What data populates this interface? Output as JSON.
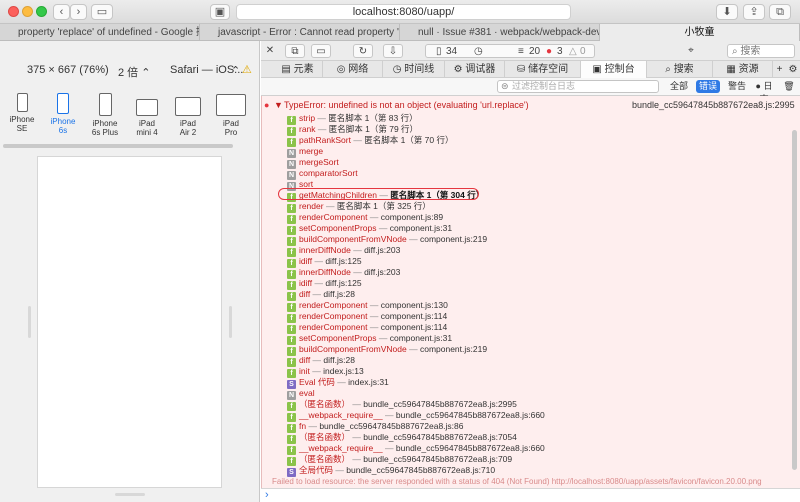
{
  "window": {
    "url": "localhost:8080/uapp/",
    "colors": {
      "accent": "#2f7ae5",
      "error": "#c21d1d",
      "function_badge": "#8bc34a",
      "native_badge": "#9e9e9e",
      "script_badge": "#7e6bc4"
    }
  },
  "tabs": [
    {
      "label": "property 'replace' of undefined - Google 搜索"
    },
    {
      "label": "javascript - Error : Cannot read property 'replace'..."
    },
    {
      "label": "null · Issue #381 · webpack/webpack-dev-server"
    },
    {
      "label": "小牧童"
    }
  ],
  "device_bar": {
    "resolution": "375 × 667 (76%)",
    "scale": "2 倍 ⌃",
    "browser": "Safari — iOS...",
    "warning_icon": "warning-icon"
  },
  "devices": [
    {
      "label1": "iPhone",
      "label2": "SE"
    },
    {
      "label1": "iPhone",
      "label2": "6s"
    },
    {
      "label1": "iPhone",
      "label2": "6s Plus"
    },
    {
      "label1": "iPad",
      "label2": "mini 4"
    },
    {
      "label1": "iPad",
      "label2": "Air 2"
    },
    {
      "label1": "iPad",
      "label2": "Pro"
    }
  ],
  "inspector_toolbar": {
    "stats": [
      {
        "icon": "document-icon",
        "value": "34"
      },
      {
        "icon": "clock-icon",
        "value": ""
      },
      {
        "icon": "list-icon",
        "value": "20"
      },
      {
        "icon": "error-icon",
        "value": "3"
      },
      {
        "icon": "warning-icon",
        "value": "0"
      }
    ],
    "search_placeholder": "搜索"
  },
  "panels": [
    {
      "label": "元素",
      "icon": "elements-icon"
    },
    {
      "label": "网络",
      "icon": "network-icon"
    },
    {
      "label": "时间线",
      "icon": "timeline-icon"
    },
    {
      "label": "调试器",
      "icon": "debugger-icon"
    },
    {
      "label": "储存空间",
      "icon": "storage-icon"
    },
    {
      "label": "控制台",
      "icon": "console-icon"
    },
    {
      "label": "搜索",
      "icon": "search-icon"
    },
    {
      "label": "资源",
      "icon": "resources-icon"
    }
  ],
  "filter": {
    "placeholder": "过滤控制台日志",
    "buttons": [
      {
        "label": "全部"
      },
      {
        "label": "错误"
      },
      {
        "label": "警告"
      },
      {
        "label": "日志"
      }
    ]
  },
  "error": {
    "message": "TypeError: undefined is not an object (evaluating 'url.replace')",
    "source": "bundle_cc59647845b887672ea8.js:2995"
  },
  "stack": [
    {
      "badge": "f",
      "fn": "strip",
      "loc": "匿名脚本 1（第 83 行）"
    },
    {
      "badge": "f",
      "fn": "rank",
      "loc": "匿名脚本 1（第 79 行）"
    },
    {
      "badge": "f",
      "fn": "pathRankSort",
      "loc": "匿名脚本 1（第 70 行）"
    },
    {
      "badge": "N",
      "fn": "merge",
      "loc": ""
    },
    {
      "badge": "N",
      "fn": "mergeSort",
      "loc": ""
    },
    {
      "badge": "N",
      "fn": "comparatorSort",
      "loc": ""
    },
    {
      "badge": "N",
      "fn": "sort",
      "loc": ""
    },
    {
      "badge": "f",
      "fn": "getMatchingChildren",
      "loc": "匿名脚本 1（第 304 行）"
    },
    {
      "badge": "f",
      "fn": "render",
      "loc": "匿名脚本 1（第 325 行）"
    },
    {
      "badge": "f",
      "fn": "renderComponent",
      "loc": "component.js:89"
    },
    {
      "badge": "f",
      "fn": "setComponentProps",
      "loc": "component.js:31"
    },
    {
      "badge": "f",
      "fn": "buildComponentFromVNode",
      "loc": "component.js:219"
    },
    {
      "badge": "f",
      "fn": "innerDiffNode",
      "loc": "diff.js:203"
    },
    {
      "badge": "f",
      "fn": "idiff",
      "loc": "diff.js:125"
    },
    {
      "badge": "f",
      "fn": "innerDiffNode",
      "loc": "diff.js:203"
    },
    {
      "badge": "f",
      "fn": "idiff",
      "loc": "diff.js:125"
    },
    {
      "badge": "f",
      "fn": "diff",
      "loc": "diff.js:28"
    },
    {
      "badge": "f",
      "fn": "renderComponent",
      "loc": "component.js:130"
    },
    {
      "badge": "f",
      "fn": "renderComponent",
      "loc": "component.js:114"
    },
    {
      "badge": "f",
      "fn": "renderComponent",
      "loc": "component.js:114"
    },
    {
      "badge": "f",
      "fn": "setComponentProps",
      "loc": "component.js:31"
    },
    {
      "badge": "f",
      "fn": "buildComponentFromVNode",
      "loc": "component.js:219"
    },
    {
      "badge": "f",
      "fn": "diff",
      "loc": "diff.js:28"
    },
    {
      "badge": "f",
      "fn": "init",
      "loc": "index.js:13"
    },
    {
      "badge": "S",
      "fn": "Eval 代码",
      "loc": "index.js:31"
    },
    {
      "badge": "N",
      "fn": "eval",
      "loc": ""
    },
    {
      "badge": "f",
      "fn": "（匿名函数）",
      "loc": "bundle_cc59647845b887672ea8.js:2995"
    },
    {
      "badge": "f",
      "fn": "__webpack_require__",
      "loc": "bundle_cc59647845b887672ea8.js:660"
    },
    {
      "badge": "f",
      "fn": "fn",
      "loc": "bundle_cc59647845b887672ea8.js:86"
    },
    {
      "badge": "f",
      "fn": "（匿名函数）",
      "loc": "bundle_cc59647845b887672ea8.js:7054"
    },
    {
      "badge": "f",
      "fn": "__webpack_require__",
      "loc": "bundle_cc59647845b887672ea8.js:660"
    },
    {
      "badge": "f",
      "fn": "（匿名函数）",
      "loc": "bundle_cc59647845b887672ea8.js:709"
    },
    {
      "badge": "S",
      "fn": "全局代码",
      "loc": "bundle_cc59647845b887672ea8.js:710"
    }
  ],
  "next_message": "Failed to load resource: the server responded with a status of 404 (Not Found)  http://localhost:8080/uapp/assets/favicon/favicon.20.00.png",
  "prompt_symbol": "›"
}
